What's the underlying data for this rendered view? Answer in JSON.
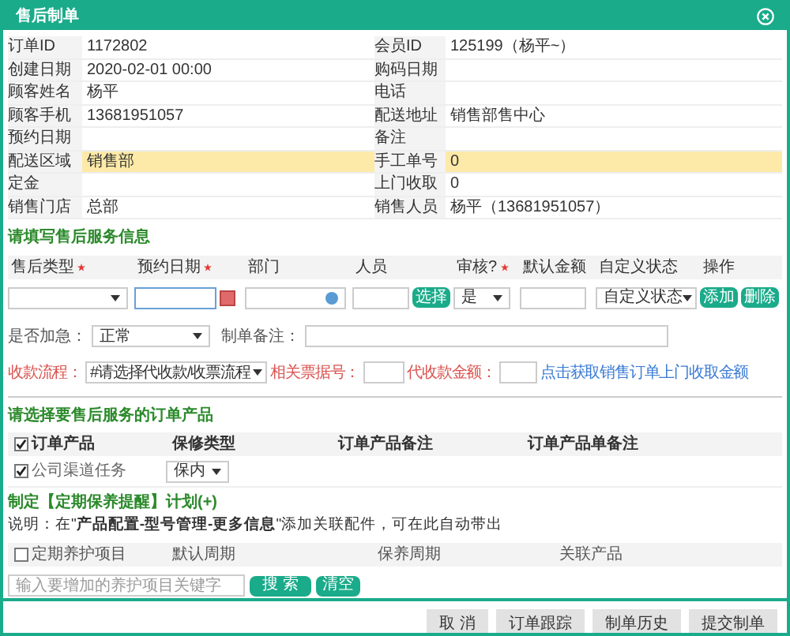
{
  "window": {
    "title": "售后制单"
  },
  "info_rows": [
    {
      "left_label": "订单ID",
      "left_value": "1172802",
      "right_label": "会员ID",
      "right_value": "125199（杨平~）",
      "highlighted": false
    },
    {
      "left_label": "创建日期",
      "left_value": "2020-02-01 00:00",
      "right_label": "购码日期",
      "highlighted": false
    },
    {
      "left_label": "顾客姓名",
      "left_value": "杨平",
      "right_label": "电话",
      "highlighted": false
    },
    {
      "left_label": "顾客手机",
      "left_value": "13681951057",
      "right_label": "配送地址",
      "right_value": "销售部售中心",
      "highlighted": false
    },
    {
      "left_label": "预约日期",
      "right_label": "备注",
      "highlighted": false
    },
    {
      "left_label": "配送区域",
      "left_value": "销售部",
      "right_label": "手工单号",
      "right_value": "0",
      "highlighted": true
    },
    {
      "left_label": "定金",
      "right_label": "上门收取",
      "right_value": "0",
      "highlighted": false
    },
    {
      "left_label": "销售门店",
      "left_value": "总部",
      "right_label": "销售人员",
      "right_value": "杨平（13681951057）",
      "highlighted": false
    }
  ],
  "service_section": {
    "title": "请填写售后服务信息",
    "columns": [
      {
        "label": "售后类型",
        "required": true
      },
      {
        "label": "预约日期",
        "required": true
      },
      {
        "label": "部门",
        "required": false
      },
      {
        "label": "人员",
        "required": false
      },
      {
        "label": "审核?",
        "required": true
      },
      {
        "label": "默认金额",
        "required": false
      },
      {
        "label": "自定义状态",
        "required": false
      },
      {
        "label": "操作",
        "required": false
      }
    ],
    "audit_value": "是",
    "custom_status": "自定义状态",
    "pick_button": "选择",
    "add_button": "添加",
    "delete_button": "删除",
    "urgent_label": "是否加急：",
    "urgent_value": "正常",
    "remark_label": "制单备注：",
    "payment_flow_label": "收款流程：",
    "payment_flow_value": "#请选择代收款/收票流程",
    "receipt_label": "相关票据号：",
    "amount_label": "代收款金额：",
    "fetch_link": "点击获取销售订单上门收取金额"
  },
  "products_section": {
    "title": "请选择要售后服务的订单产品",
    "columns": [
      {
        "label": "订单产品",
        "checked": true
      },
      {
        "label": "保修类型"
      },
      {
        "label": "订单产品备注"
      },
      {
        "label": "订单产品单备注"
      }
    ],
    "rows": [
      {
        "name": "公司渠道任务",
        "checked": true,
        "warranty": "保内"
      }
    ]
  },
  "maintenance": {
    "title": "制定【定期保养提醒】计划(+)",
    "note": "说明：在\"**产品配置-型号管理-更多信息**\"添加关联配件，可在此自动带出",
    "columns": [
      {
        "label": "定期养护项目",
        "checked": false
      },
      {
        "label": "默认周期"
      },
      {
        "label": "保养周期"
      },
      {
        "label": "关联产品"
      }
    ],
    "search_placeholder": "输入要增加的养护项目关键字",
    "search_button": "搜 索",
    "clear_button": "清空"
  },
  "footer_buttons": [
    "取 消",
    "订单跟踪",
    "制单历史",
    "提交制单"
  ]
}
